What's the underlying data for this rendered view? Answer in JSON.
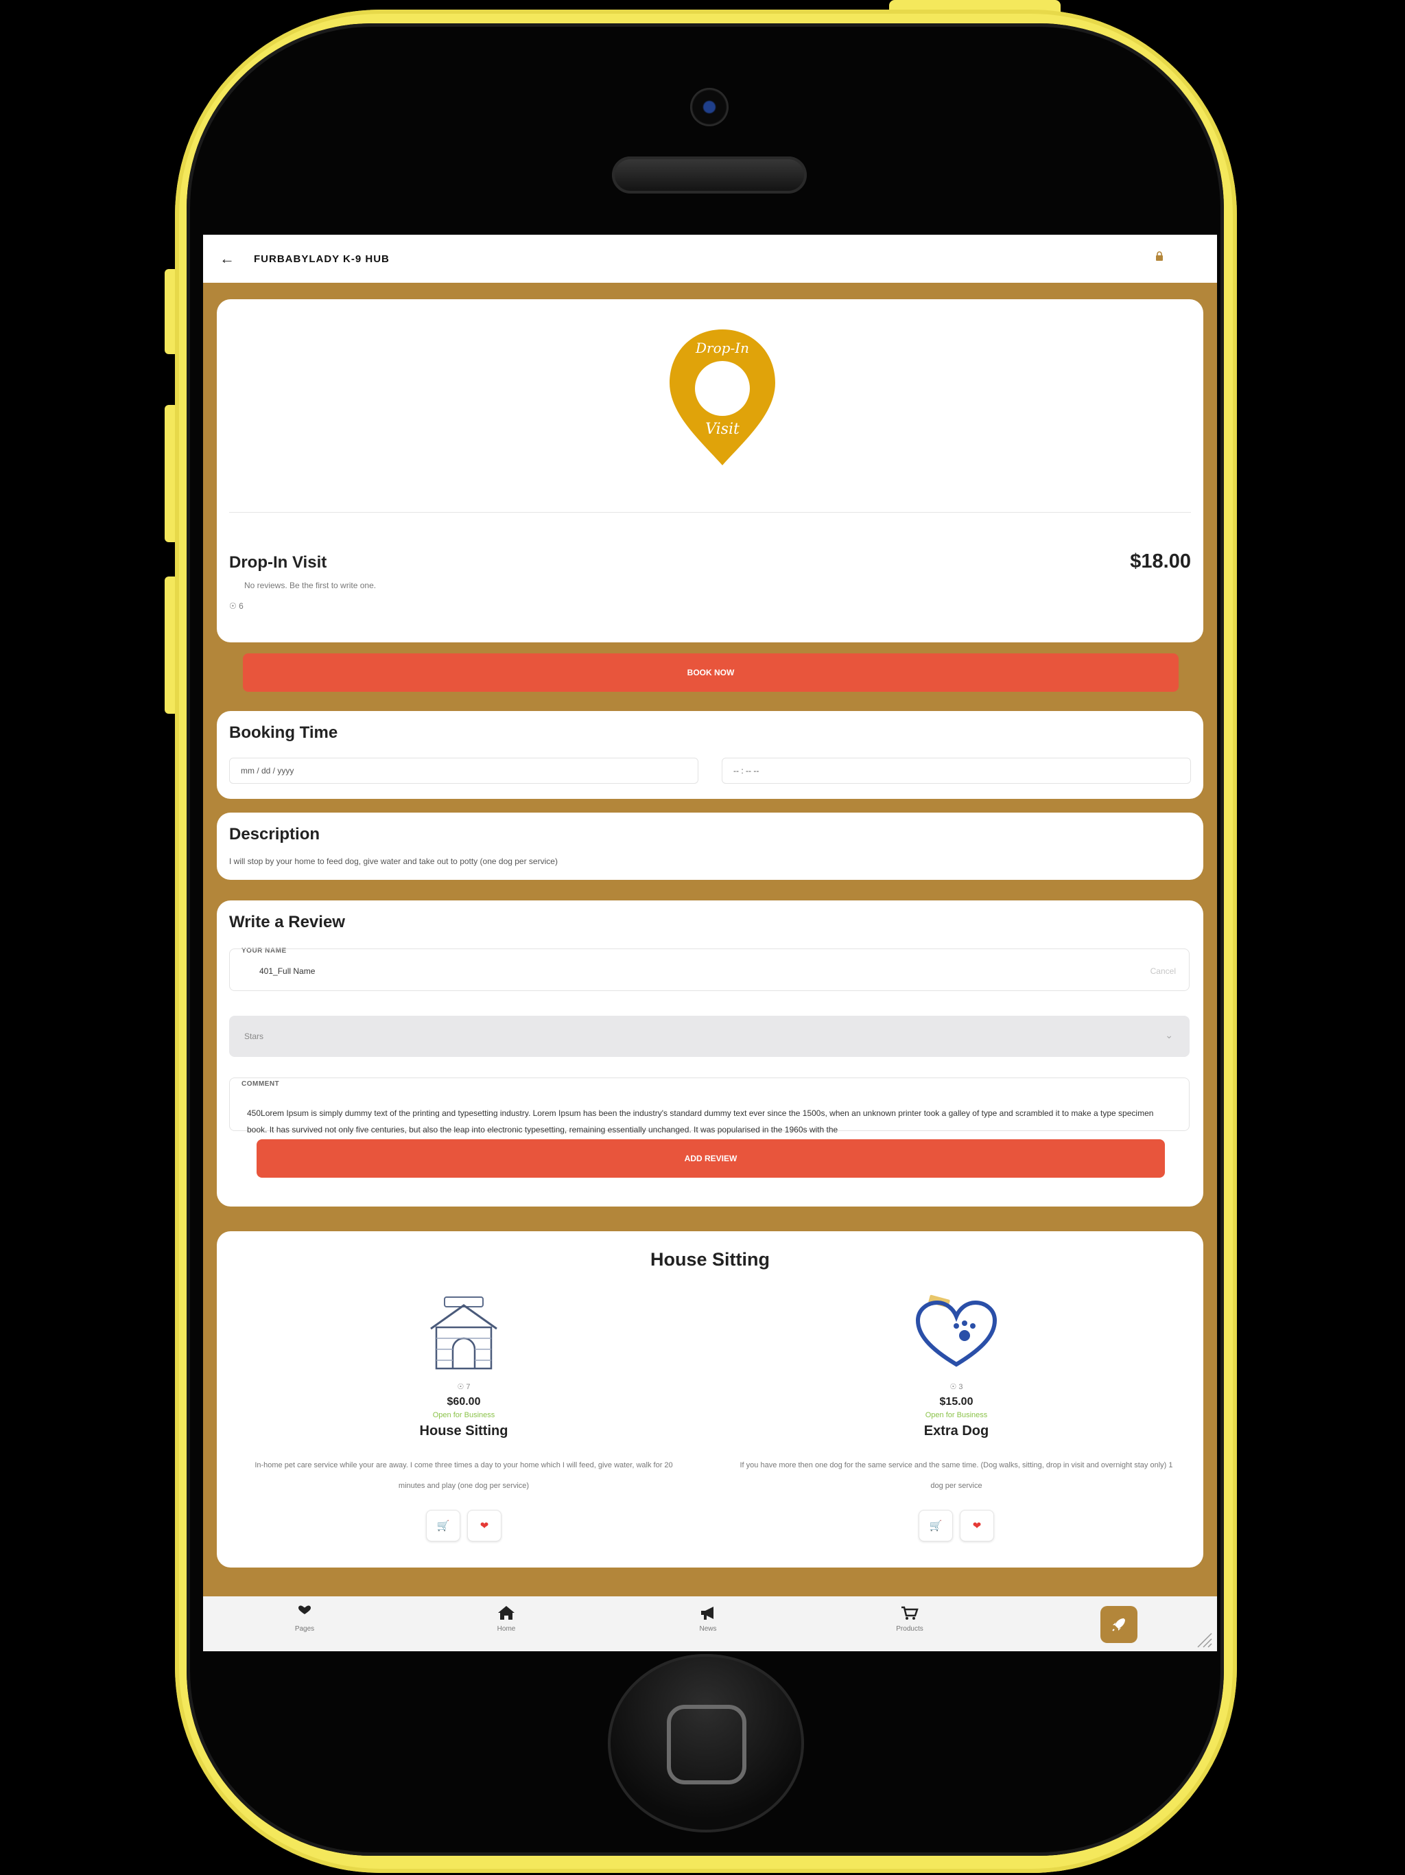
{
  "colors": {
    "phone_frame": "#f4e85c",
    "screen_background": "#b3863a",
    "accent_button": "#e8553c",
    "pin_gold": "#e0a30a",
    "status_green": "#8bc34a"
  },
  "header": {
    "back_icon": "arrow-left-icon",
    "title": "FURBABYLADY K-9 HUB",
    "lock_icon": "lock-icon"
  },
  "product": {
    "image_text_top": "Drop-In",
    "image_text_bottom": "Visit",
    "name": "Drop-In Visit",
    "price": "$18.00",
    "no_reviews": "No reviews. Be the first to write one.",
    "views": "6",
    "book_now": "BOOK NOW"
  },
  "booking": {
    "title": "Booking Time",
    "date_placeholder": "mm / dd / yyyy",
    "time_placeholder": "-- : -- --"
  },
  "description": {
    "title": "Description",
    "text": "I will stop by your home to feed dog, give water and take out to potty (one dog per service)"
  },
  "review": {
    "title": "Write a Review",
    "name_label": "YOUR NAME",
    "name_value": "401_Full Name",
    "cancel": "Cancel",
    "stars_placeholder": "Stars",
    "comment_label": "COMMENT",
    "comment_value": "450Lorem Ipsum is simply dummy text of the printing and typesetting industry. Lorem Ipsum has been the industry's standard dummy text ever since the 1500s, when an unknown printer took a galley of type and scrambled it to make a type specimen book. It has survived not only five centuries, but also the leap into electronic typesetting, remaining essentially unchanged. It was popularised in the 1960s with the",
    "add_review": "ADD REVIEW"
  },
  "related": {
    "title": "House Sitting",
    "items": [
      {
        "views": "7",
        "price": "$60.00",
        "status": "Open for Business",
        "name": "House Sitting",
        "description": "In-home pet care service while your are away. I come three times a day to your home which I will feed, give water, walk for 20 minutes and play (one dog per service)"
      },
      {
        "views": "3",
        "price": "$15.00",
        "status": "Open for Business",
        "name": "Extra Dog",
        "description": "If you have more then one dog for the same service and the same time. (Dog walks, sitting, drop in visit and overnight stay only) 1 dog per service"
      }
    ]
  },
  "nav": {
    "items": [
      {
        "label": "Pages",
        "icon": "heart-icon"
      },
      {
        "label": "Home",
        "icon": "home-icon"
      },
      {
        "label": "News",
        "icon": "megaphone-icon"
      },
      {
        "label": "Products",
        "icon": "cart-icon"
      }
    ],
    "fab_icon": "rocket-icon"
  }
}
